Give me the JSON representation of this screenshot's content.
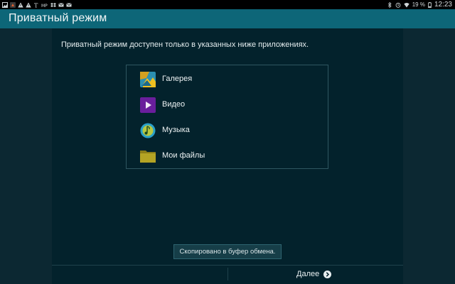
{
  "status_bar": {
    "left_icons": [
      "gallery-icon",
      "app-icon",
      "warning-icon",
      "warning-icon",
      "nyt-icon",
      "mms-icon",
      "dropbox-icon",
      "mail-icon",
      "mail-icon"
    ],
    "right_icons": [
      "bluetooth-icon",
      "alarm-icon",
      "wifi-icon"
    ],
    "battery": "19 %",
    "time": "12:23"
  },
  "app_bar": {
    "title": "Приватный режим"
  },
  "main": {
    "intro": "Приватный режим доступен только в указанных ниже приложениях.",
    "apps": [
      {
        "label": "Галерея",
        "icon": "gallery-app-icon"
      },
      {
        "label": "Видео",
        "icon": "video-app-icon"
      },
      {
        "label": "Музыка",
        "icon": "music-app-icon"
      },
      {
        "label": "Мои файлы",
        "icon": "my-files-app-icon"
      }
    ],
    "toast": "Скопировано в буфер обмена.",
    "next_label": "Далее"
  },
  "colors": {
    "app_bar": "#0d6678",
    "panel": "#03222c",
    "background": "#0c2832"
  }
}
